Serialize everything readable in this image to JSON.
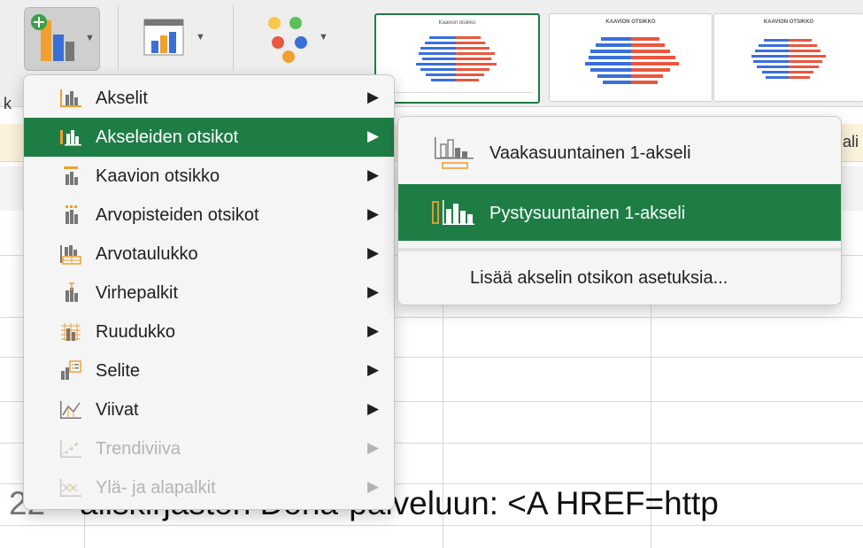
{
  "ribbon": {
    "add_chart_element_icon": "add-chart-element-icon",
    "quick_layout_icon": "quick-layout-icon",
    "change_colors_icon": "change-colors-icon",
    "chart_styles": [
      {
        "title": "Kaavion otsikko"
      },
      {
        "title": "KAAVION OTSIKKO"
      },
      {
        "title": "KAAVION OTSIKKO"
      }
    ]
  },
  "menu": {
    "items": [
      {
        "label": "Akselit",
        "icon": "axes-icon",
        "enabled": true
      },
      {
        "label": "Akseleiden otsikot",
        "icon": "axis-titles-icon",
        "enabled": true,
        "highlighted": true
      },
      {
        "label": "Kaavion otsikko",
        "icon": "chart-title-icon",
        "enabled": true
      },
      {
        "label": "Arvopisteiden otsikot",
        "icon": "data-labels-icon",
        "enabled": true
      },
      {
        "label": "Arvotaulukko",
        "icon": "data-table-icon",
        "enabled": true
      },
      {
        "label": "Virhepalkit",
        "icon": "error-bars-icon",
        "enabled": true
      },
      {
        "label": "Ruudukko",
        "icon": "gridlines-icon",
        "enabled": true
      },
      {
        "label": "Selite",
        "icon": "legend-icon",
        "enabled": true
      },
      {
        "label": "Viivat",
        "icon": "lines-icon",
        "enabled": true
      },
      {
        "label": "Trendiviiva",
        "icon": "trendline-icon",
        "enabled": false
      },
      {
        "label": "Ylä- ja alapalkit",
        "icon": "up-down-bars-icon",
        "enabled": false
      }
    ],
    "arrow": "▶"
  },
  "submenu": {
    "items": [
      {
        "label": "Vaakasuuntainen 1-akseli",
        "icon": "primary-horizontal-axis-title-icon"
      },
      {
        "label": "Pystysuuntainen 1-akseli",
        "icon": "primary-vertical-axis-title-icon",
        "highlighted": true
      }
    ],
    "more_options": "Lisää akselin otsikon asetuksia..."
  },
  "sheet": {
    "cell_text": "aliskirjaston Doria-palveluun: <A HREF=http",
    "row_number": "22",
    "row_label_fragment": "k",
    "infobar_fragment": "ali"
  },
  "colors": {
    "highlight": "#1e7d45",
    "orange": "#f0a030",
    "menu_bg": "#f5f5f5"
  }
}
